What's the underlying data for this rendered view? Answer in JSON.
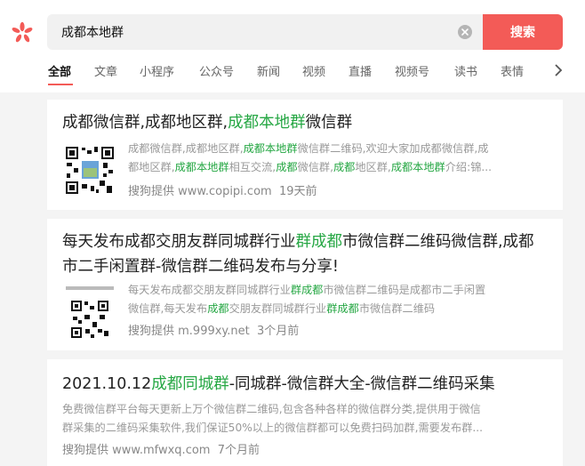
{
  "search": {
    "query": "成都本地群",
    "button_label": "搜索"
  },
  "tabs": [
    "全部",
    "文章",
    "小程序",
    "公众号",
    "新闻",
    "视频",
    "直播",
    "视频号",
    "读书",
    "表情"
  ],
  "colors": {
    "accent": "#f35b57",
    "highlight": "#26a744"
  },
  "results": [
    {
      "title": [
        "成都微信群,成都地区群,",
        "成都本地群",
        "微信群"
      ],
      "desc_line1": [
        "成都微信群,成都地区群,",
        "成都本地群",
        "微信群二维码,欢迎大家加成都微信群,成"
      ],
      "desc_line2": [
        "都地区群,",
        "成都本地群",
        "相互交流,",
        "成都",
        "微信群,",
        "成都",
        "地区群,",
        "成都本地群",
        "介绍:锦..."
      ],
      "source": "搜狗提供 www.copipi.com",
      "time": "19天前"
    },
    {
      "title_line1": [
        "每天发布成都交朋友群同城群行业",
        "群成都",
        "市微信群二维码微信群,成都"
      ],
      "title_line2": "市二手闲置群-微信群二维码发布与分享!",
      "desc_line1": [
        "每天发布成都交朋友群同城群行业",
        "群成都",
        "市微信群二维码是成都市二手闲置"
      ],
      "desc_line2": [
        "微信群,每天发布",
        "成都",
        "交朋友群同城群行业",
        "群成都",
        "市微信群二维码"
      ],
      "source": "搜狗提供 m.999xy.net",
      "time": "3个月前"
    },
    {
      "title": [
        "2021.10.12",
        "成都同城群",
        "-同城群-微信群大全-微信群二维码采集"
      ],
      "desc_line1": "免费微信群平台每天更新上万个微信群二维码,包含各种各样的微信群分类,提供用于微信",
      "desc_line2": "群采集的二维码采集软件,我们保证50%以上的微信群都可以免费扫码加群,需要发布群...",
      "source": "搜狗提供 www.mfwxq.com",
      "time": "7个月前"
    }
  ]
}
